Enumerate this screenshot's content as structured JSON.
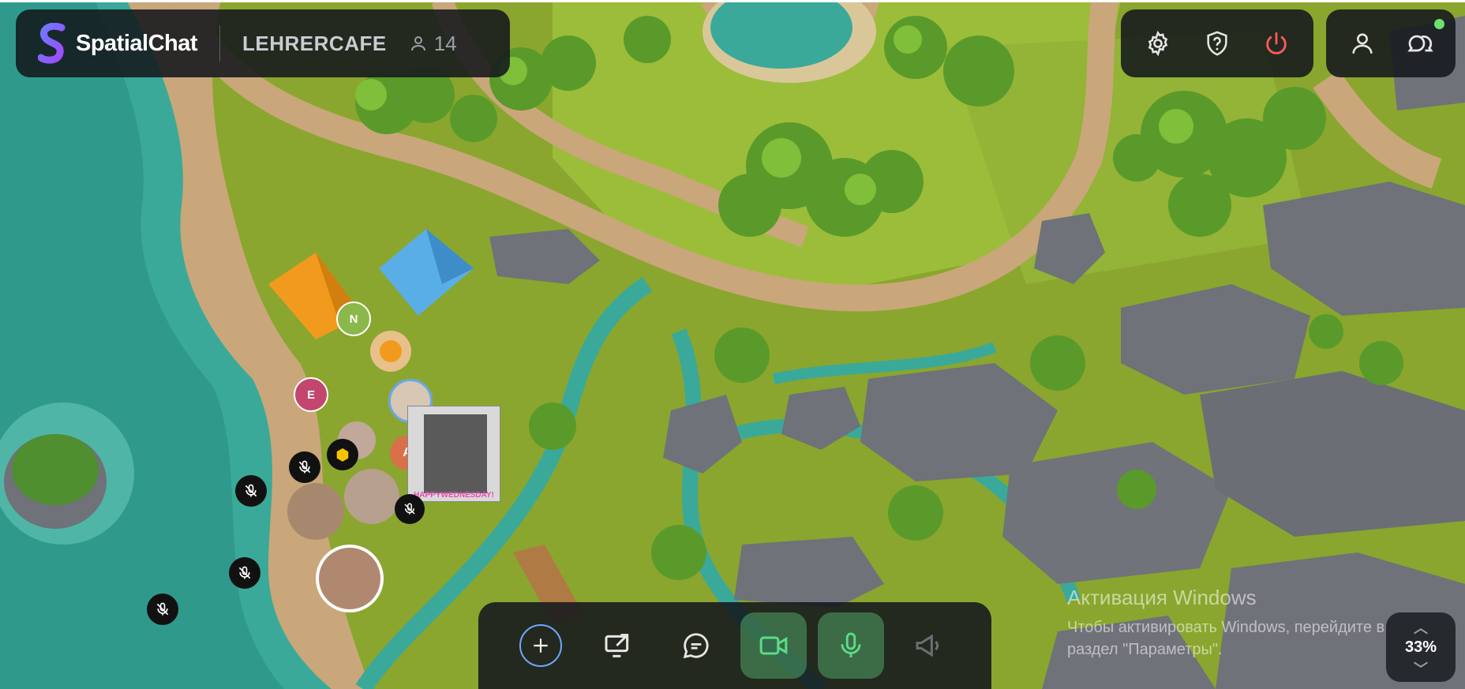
{
  "header": {
    "brand": "SpatialChat",
    "room_name": "LEHRERCAFE",
    "participant_count": "14"
  },
  "avatars": {
    "initials": [
      "N",
      "E",
      "A"
    ],
    "gif_caption": "HAPPYWEDNESDAY!"
  },
  "icons": {
    "settings": "gear-icon",
    "help": "question-shield-icon",
    "leave": "power-icon",
    "profile": "user-icon",
    "chat": "chat-bubbles-icon"
  },
  "toolbar": {
    "items": [
      "add",
      "share-screen",
      "chat",
      "camera",
      "microphone",
      "broadcast"
    ]
  },
  "zoom": {
    "level": "33%"
  },
  "watermark": {
    "title": "Активация Windows",
    "body": "Чтобы активировать Windows, перейдите в раздел \"Параметры\"."
  },
  "colors": {
    "water": "#3aa99a",
    "grass": "#8fae34",
    "path": "#c9a77a",
    "leave_red": "#ff5a5a",
    "active_green": "#5cbe78",
    "online": "#6ee06e"
  }
}
